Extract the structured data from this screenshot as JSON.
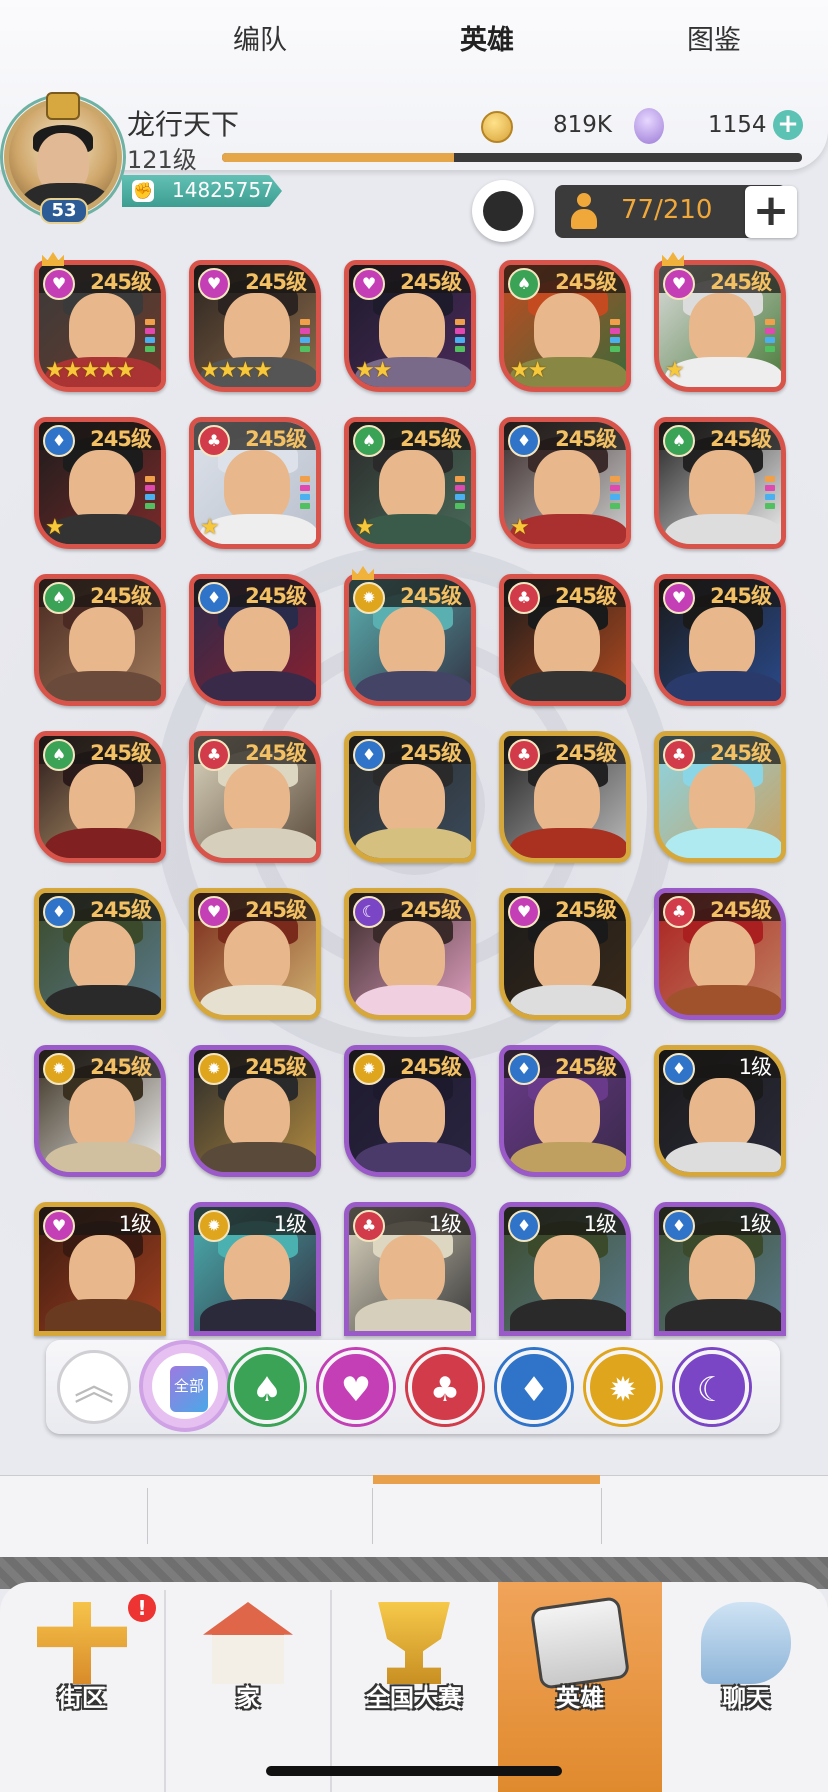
{
  "player": {
    "name": "龙行天下",
    "level": "121级",
    "badge_level": "53",
    "power": "14825757",
    "xp_fraction": 0.4,
    "gold": "819K",
    "diamonds": "1154"
  },
  "hero_slots": {
    "text": "77/210"
  },
  "heroes": [
    {
      "level": "245级",
      "faction": "heart",
      "frame": "red",
      "stars": 5,
      "crown": true
    },
    {
      "level": "245级",
      "faction": "heart",
      "frame": "red",
      "stars": 4,
      "crown": false
    },
    {
      "level": "245级",
      "faction": "heart",
      "frame": "red",
      "stars": 2,
      "crown": false
    },
    {
      "level": "245级",
      "faction": "spade",
      "frame": "red",
      "stars": 2,
      "crown": false
    },
    {
      "level": "245级",
      "faction": "heart",
      "frame": "red",
      "stars": 1,
      "crown": true
    },
    {
      "level": "245级",
      "faction": "diamond",
      "frame": "red",
      "stars": 1,
      "crown": false
    },
    {
      "level": "245级",
      "faction": "club",
      "frame": "red",
      "stars": 1,
      "crown": false
    },
    {
      "level": "245级",
      "faction": "spade",
      "frame": "red",
      "stars": 1,
      "crown": false
    },
    {
      "level": "245级",
      "faction": "diamond",
      "frame": "red",
      "stars": 1,
      "crown": false
    },
    {
      "level": "245级",
      "faction": "spade",
      "frame": "red",
      "stars": 0,
      "crown": false
    },
    {
      "level": "245级",
      "faction": "spade",
      "frame": "red",
      "stars": 0,
      "crown": false
    },
    {
      "level": "245级",
      "faction": "diamond",
      "frame": "red",
      "stars": 0,
      "crown": false
    },
    {
      "level": "245级",
      "faction": "sun",
      "frame": "red",
      "stars": 0,
      "crown": true
    },
    {
      "level": "245级",
      "faction": "club",
      "frame": "red",
      "stars": 0,
      "crown": false
    },
    {
      "level": "245级",
      "faction": "heart",
      "frame": "red",
      "stars": 0,
      "crown": false
    },
    {
      "level": "245级",
      "faction": "spade",
      "frame": "red",
      "stars": 0,
      "crown": false
    },
    {
      "level": "245级",
      "faction": "club",
      "frame": "red",
      "stars": 0,
      "crown": false
    },
    {
      "level": "245级",
      "faction": "diamond",
      "frame": "gold",
      "stars": 0,
      "crown": false
    },
    {
      "level": "245级",
      "faction": "club",
      "frame": "gold",
      "stars": 0,
      "crown": false
    },
    {
      "level": "245级",
      "faction": "club",
      "frame": "gold",
      "stars": 0,
      "crown": false
    },
    {
      "level": "245级",
      "faction": "diamond",
      "frame": "gold",
      "stars": 0,
      "crown": false
    },
    {
      "level": "245级",
      "faction": "heart",
      "frame": "gold",
      "stars": 0,
      "crown": false
    },
    {
      "level": "245级",
      "faction": "moon",
      "frame": "gold",
      "stars": 0,
      "crown": false
    },
    {
      "level": "245级",
      "faction": "heart",
      "frame": "gold",
      "stars": 0,
      "crown": false
    },
    {
      "level": "245级",
      "faction": "club",
      "frame": "purple",
      "stars": 0,
      "crown": false
    },
    {
      "level": "245级",
      "faction": "sun",
      "frame": "purple",
      "stars": 0,
      "crown": false
    },
    {
      "level": "245级",
      "faction": "sun",
      "frame": "purple",
      "stars": 0,
      "crown": false
    },
    {
      "level": "245级",
      "faction": "sun",
      "frame": "purple",
      "stars": 0,
      "crown": false
    },
    {
      "level": "245级",
      "faction": "diamond",
      "frame": "purple",
      "stars": 0,
      "crown": false
    },
    {
      "level": "1级",
      "faction": "diamond",
      "frame": "gold",
      "stars": 0,
      "crown": false
    },
    {
      "level": "1级",
      "faction": "heart",
      "frame": "gold",
      "stars": 0,
      "crown": false
    },
    {
      "level": "1级",
      "faction": "sun",
      "frame": "purple",
      "stars": 0,
      "crown": false
    },
    {
      "level": "1级",
      "faction": "club",
      "frame": "purple",
      "stars": 0,
      "crown": false
    },
    {
      "level": "1级",
      "faction": "diamond",
      "frame": "purple",
      "stars": 0,
      "crown": false
    },
    {
      "level": "1级",
      "faction": "diamond",
      "frame": "purple",
      "stars": 0,
      "crown": false
    }
  ],
  "filters": [
    {
      "name": "up-arrow"
    },
    {
      "name": "all",
      "label": "全部"
    },
    {
      "name": "spade",
      "color": "#3aa356"
    },
    {
      "name": "heart",
      "color": "#c43fb6"
    },
    {
      "name": "club",
      "color": "#d23b4a"
    },
    {
      "name": "diamond",
      "color": "#2f74c9"
    },
    {
      "name": "sun",
      "color": "#dfa51d"
    },
    {
      "name": "moon",
      "color": "#7b46c5"
    }
  ],
  "tabs": [
    "编队",
    "英雄",
    "图鉴"
  ],
  "nav": [
    "街区",
    "家",
    "全国大赛",
    "英雄",
    "聊天"
  ],
  "nav_badge": "!",
  "colors": {
    "frame_red": "#d8544a",
    "frame_gold": "#d6a83c",
    "frame_purple": "#9a5ac7",
    "accent": "#e8a04a"
  }
}
